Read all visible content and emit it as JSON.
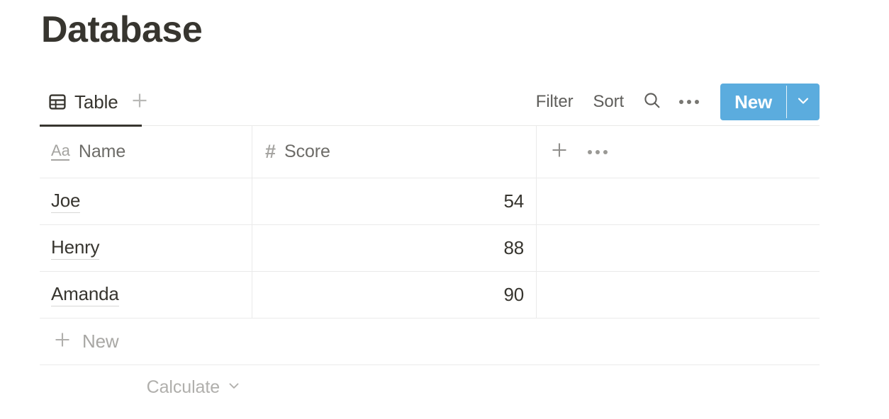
{
  "page": {
    "title": "Database"
  },
  "toolbar": {
    "view_tab": {
      "label": "Table",
      "icon": "table-icon",
      "active": true
    },
    "add_view_icon": "plus-icon",
    "filter_label": "Filter",
    "sort_label": "Sort",
    "search_icon": "search-icon",
    "more_icon": "more-horizontal-icon",
    "new_button": {
      "label": "New",
      "caret_icon": "chevron-down-icon",
      "color": "#5BACDE",
      "text_color": "#FFFFFF"
    }
  },
  "table": {
    "columns": [
      {
        "label": "Name",
        "type_icon": "text-type-icon",
        "type_glyph": "Aa"
      },
      {
        "label": "Score",
        "type_icon": "number-type-icon",
        "type_glyph": "#"
      }
    ],
    "header_actions": {
      "add_column_icon": "plus-icon",
      "column_options_icon": "more-horizontal-icon"
    },
    "rows": [
      {
        "name": "Joe",
        "score": "54"
      },
      {
        "name": "Henry",
        "score": "88"
      },
      {
        "name": "Amanda",
        "score": "90"
      }
    ],
    "new_row": {
      "label": "New",
      "icon": "plus-icon"
    },
    "footer": {
      "calculate_label": "Calculate",
      "caret_icon": "chevron-down-icon"
    }
  },
  "colors": {
    "text_primary": "#37352F",
    "text_muted": "#6D6C68",
    "text_placeholder": "#A8A7A4",
    "border": "#EAEAEA",
    "accent": "#5BACDE"
  }
}
